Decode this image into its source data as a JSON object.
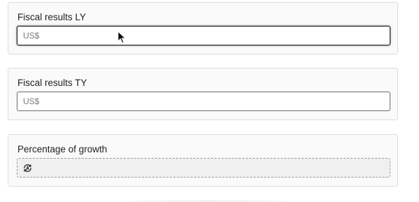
{
  "fields": [
    {
      "label": "Fiscal results LY",
      "placeholder": "US$",
      "value": ""
    },
    {
      "label": "Fiscal results TY",
      "placeholder": "US$",
      "value": ""
    },
    {
      "label": "Percentage of growth",
      "icon": "calculated-field-icon",
      "value": ""
    }
  ]
}
